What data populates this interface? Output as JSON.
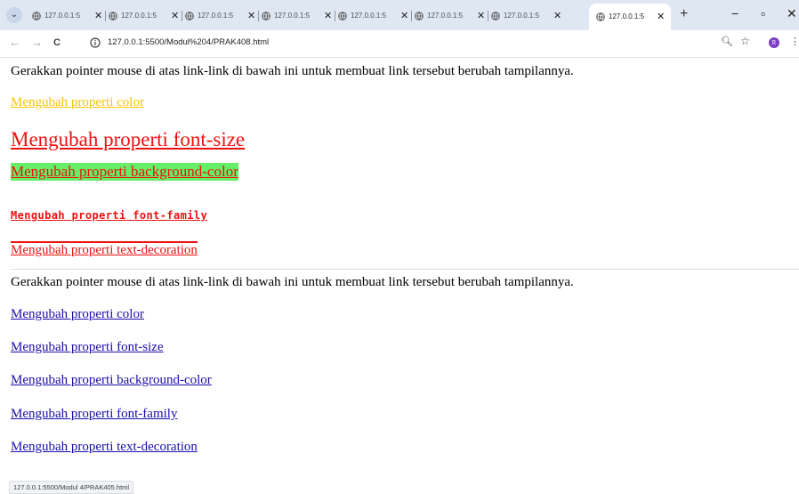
{
  "browser": {
    "tab_menu_icon": "chevron-down-icon",
    "tab_title": "127.0.0.1:5",
    "new_tab_label": "+",
    "minimize_label": "−",
    "restore_label": "▫",
    "close_label": "✕",
    "back_label": "←",
    "forward_label": "→",
    "reload_label": "C",
    "url": "127.0.0.1:5500/Modul%204/PRAK408.html",
    "avatar_letter": "R",
    "status_url": "127.0.0.1:5500/Modul 4/PRAK405.html"
  },
  "page": {
    "intro_1": "Gerakkan pointer mouse di atas link-link di bawah ini untuk membuat link tersebut berubah tampilannya.",
    "hover_links": {
      "color": "Mengubah properti color",
      "font_size": "Mengubah properti font-size",
      "background_color": "Mengubah properti background-color",
      "font_family": "Mengubah properti font-family",
      "text_decoration": "Mengubah properti text-decoration"
    },
    "intro_2": "Gerakkan pointer mouse di atas link-link di bawah ini untuk membuat link tersebut berubah tampilannya.",
    "plain_links": [
      "Mengubah properti color",
      "Mengubah properti font-size",
      "Mengubah properti background-color",
      "Mengubah properti font-family",
      "Mengubah properti text-decoration"
    ]
  },
  "colors": {
    "tabstrip": "#dfe7f3",
    "link_yellow": "#f5c400",
    "link_red": "#ee1111",
    "bg_green": "#66ee66",
    "link_blue": "#1a0dab"
  }
}
